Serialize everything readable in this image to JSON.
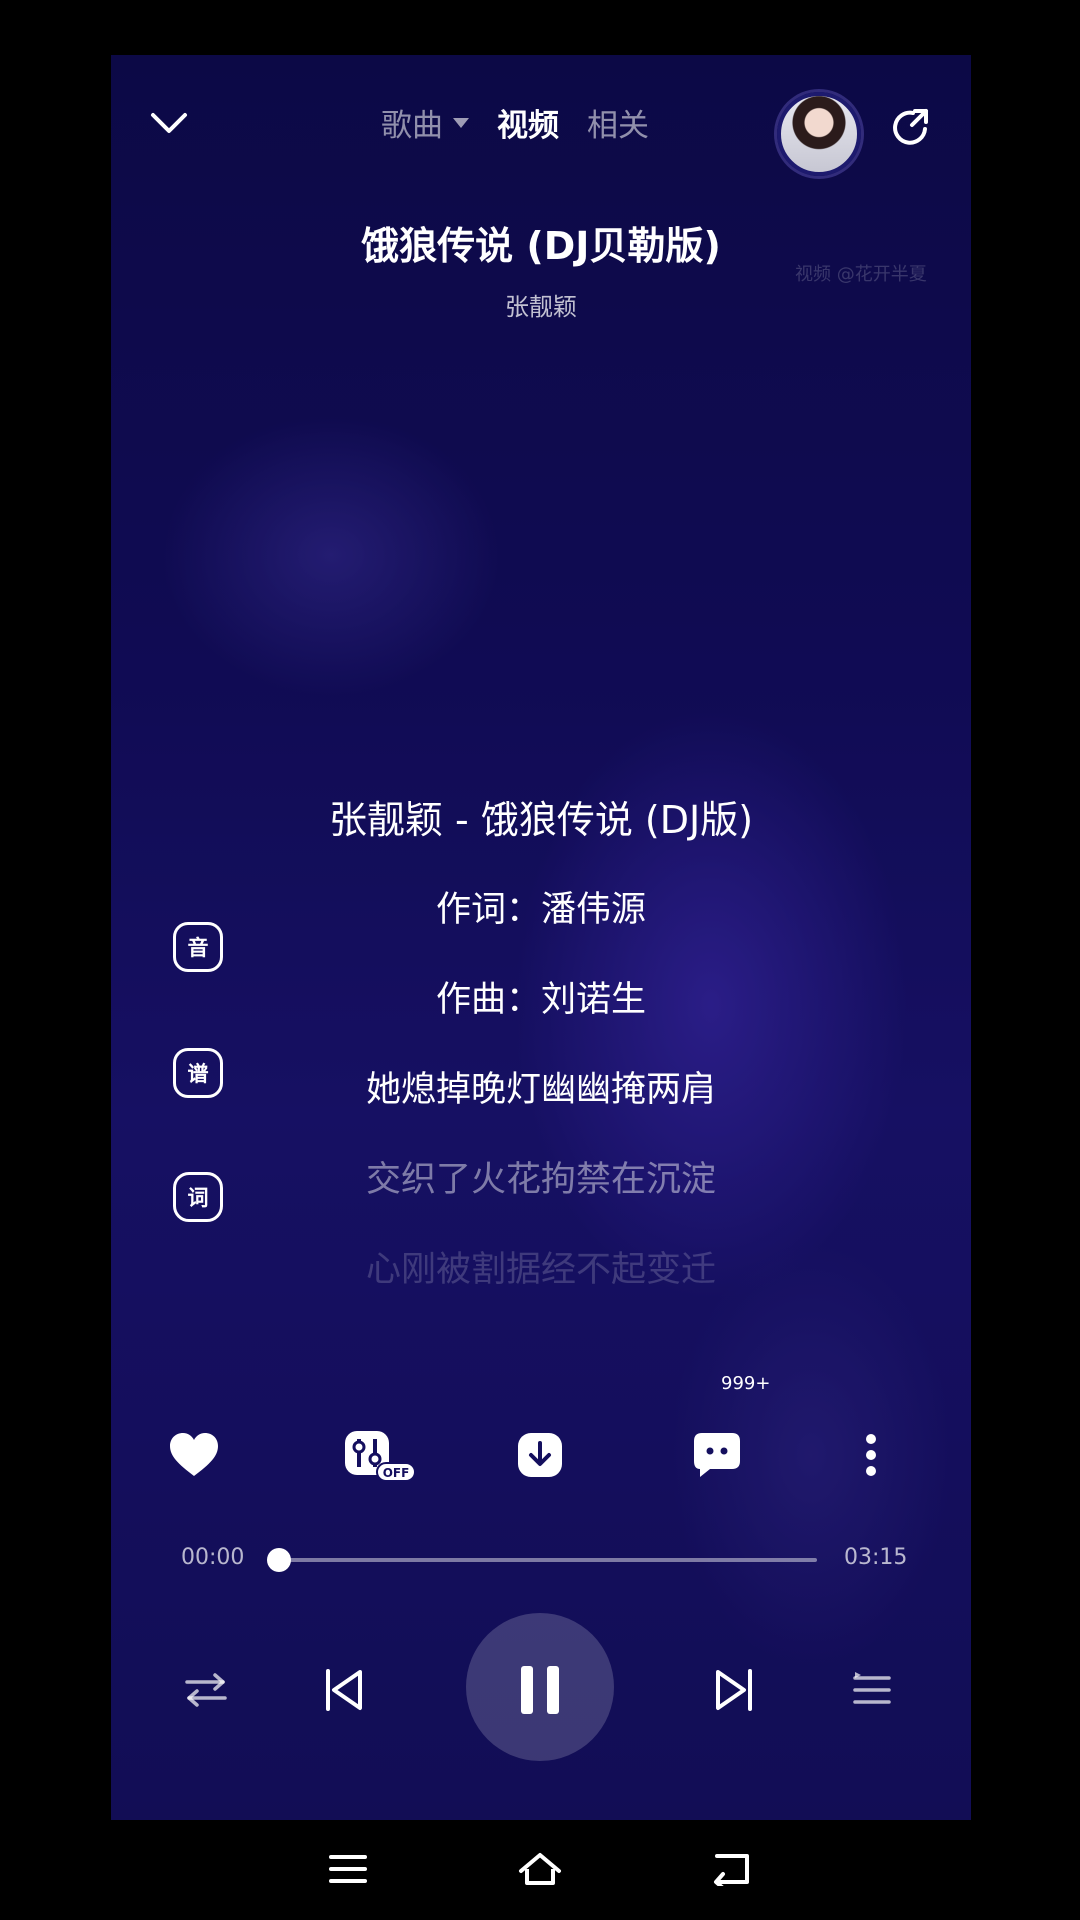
{
  "header": {
    "tabs": [
      {
        "label": "歌曲",
        "active": false,
        "has_dropdown": true
      },
      {
        "label": "视频",
        "active": true
      },
      {
        "label": "相关",
        "active": false
      }
    ],
    "icons": {
      "collapse": "chevron-down-icon",
      "share": "share-icon",
      "avatar": "avatar"
    }
  },
  "song": {
    "title": "饿狼传说 (DJ贝勒版)",
    "artist": "张靓颖",
    "watermark": "视频 @花开半夏"
  },
  "lyrics": [
    {
      "text": "张靓颖 - 饿狼传说 (DJ版)",
      "state": "current"
    },
    {
      "text": "作词：潘伟源",
      "state": "current"
    },
    {
      "text": "作曲：刘诺生",
      "state": "current"
    },
    {
      "text": "她熄掉晚灯幽幽掩两肩",
      "state": "current"
    },
    {
      "text": "交织了火花拘禁在沉淀",
      "state": "dim"
    },
    {
      "text": "心刚被割据经不起变迁",
      "state": "fade"
    }
  ],
  "side_buttons": [
    {
      "label": "音",
      "icon": "sound-quality-icon"
    },
    {
      "label": "谱",
      "icon": "score-icon"
    },
    {
      "label": "词",
      "icon": "lyrics-icon"
    }
  ],
  "actions": {
    "like": "heart-icon",
    "effects": "equalizer-icon",
    "effects_badge": "OFF",
    "download": "download-icon",
    "comments": "comment-icon",
    "comment_count": "999+",
    "more": "more-vertical-icon"
  },
  "progress": {
    "current": "00:00",
    "total": "03:15",
    "fraction": 0.0
  },
  "controls": {
    "mode": "repeat-icon",
    "prev": "previous-icon",
    "play_pause": "pause-icon",
    "next": "next-icon",
    "playlist": "playlist-icon"
  },
  "system_nav": [
    "menu-icon",
    "home-icon",
    "back-icon"
  ],
  "colors": {
    "background": "#140f5e",
    "accent": "#ffffff"
  }
}
